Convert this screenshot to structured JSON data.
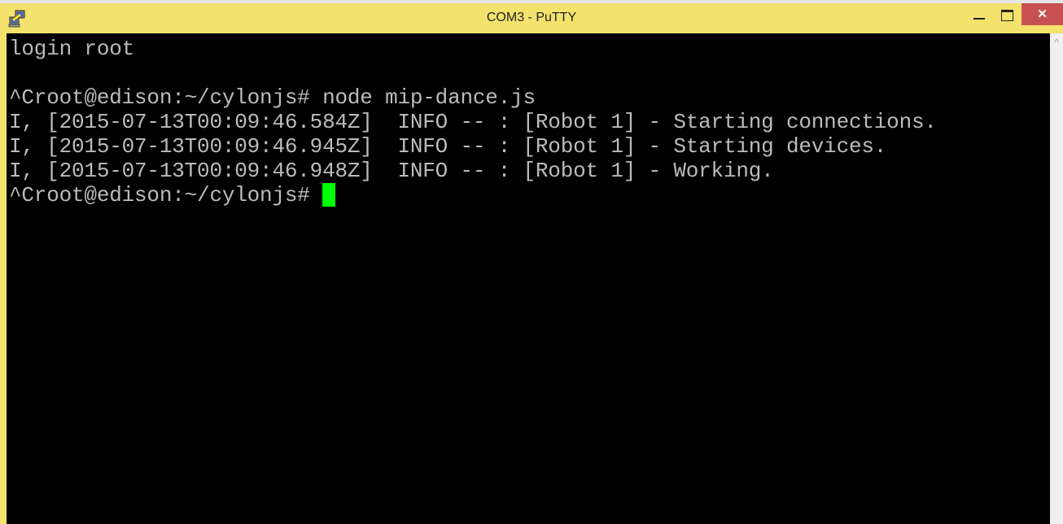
{
  "window": {
    "title": "COM3 - PuTTY",
    "app_icon": "putty-icon",
    "controls": {
      "minimize": "minimize-icon",
      "maximize": "maximize-icon",
      "close": "✕"
    },
    "accent_color": "#f3e26c",
    "close_color": "#c75050"
  },
  "terminal": {
    "background": "#000000",
    "foreground": "#bbbbbb",
    "cursor_color": "#00ff00",
    "lines": [
      "login root",
      "",
      "^Croot@edison:~/cylonjs# node mip-dance.js",
      "I, [2015-07-13T00:09:46.584Z]  INFO -- : [Robot 1] - Starting connections.",
      "I, [2015-07-13T00:09:46.945Z]  INFO -- : [Robot 1] - Starting devices.",
      "I, [2015-07-13T00:09:46.948Z]  INFO -- : [Robot 1] - Working."
    ],
    "prompt": "^Croot@edison:~/cylonjs# "
  },
  "scrollbar": {
    "up_arrow": "^"
  }
}
